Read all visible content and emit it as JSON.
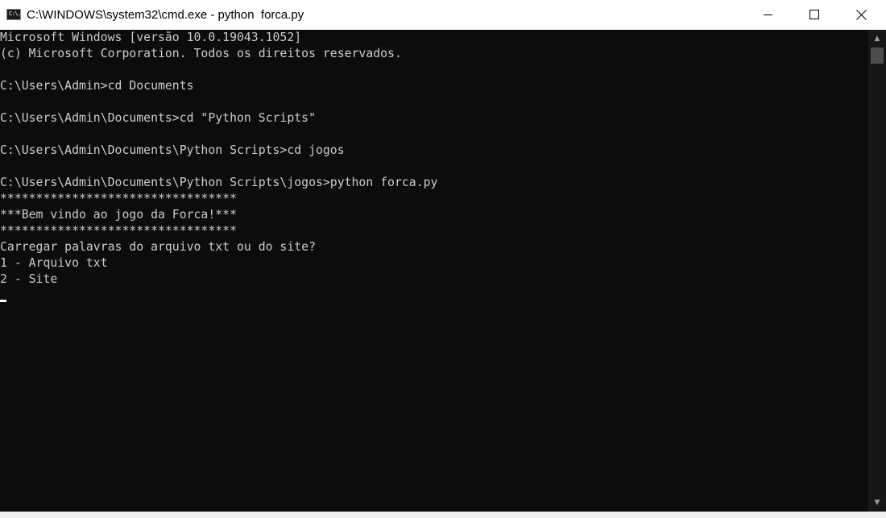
{
  "window": {
    "title": "C:\\WINDOWS\\system32\\cmd.exe - python  forca.py",
    "icon_label": "C:\\."
  },
  "controls": {
    "minimize_icon": "minimize-icon",
    "maximize_icon": "maximize-icon",
    "close_icon": "close-icon"
  },
  "console": {
    "lines": [
      "Microsoft Windows [versão 10.0.19043.1052]",
      "(c) Microsoft Corporation. Todos os direitos reservados.",
      "",
      "C:\\Users\\Admin>cd Documents",
      "",
      "C:\\Users\\Admin\\Documents>cd \"Python Scripts\"",
      "",
      "C:\\Users\\Admin\\Documents\\Python Scripts>cd jogos",
      "",
      "C:\\Users\\Admin\\Documents\\Python Scripts\\jogos>python forca.py",
      "*********************************",
      "***Bem vindo ao jogo da Forca!***",
      "*********************************",
      "Carregar palavras do arquivo txt ou do site?",
      "1 - Arquivo txt",
      "2 - Site"
    ]
  },
  "scrollbar": {
    "up_arrow": "▲",
    "down_arrow": "▼"
  },
  "colors": {
    "background": "#0c0c0c",
    "text": "#cccccc",
    "titlebar": "#ffffff"
  }
}
